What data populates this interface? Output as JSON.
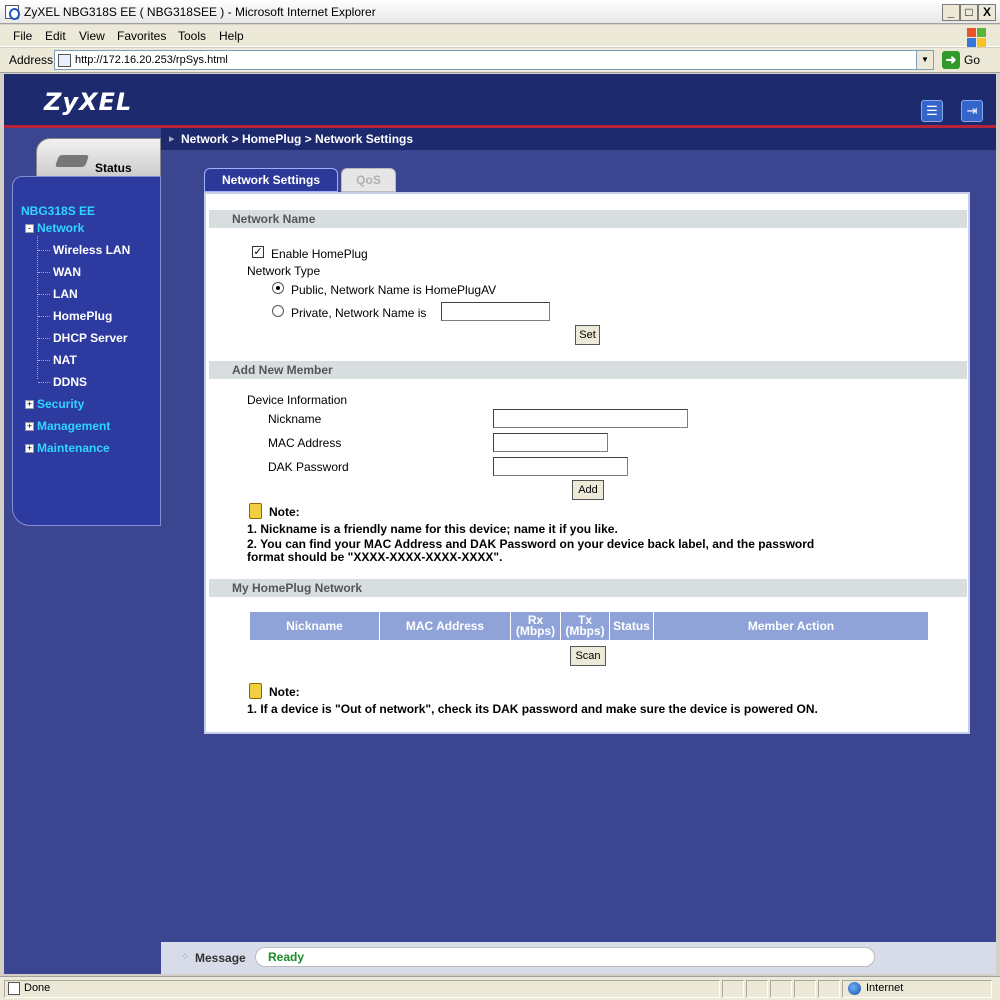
{
  "window": {
    "title": "ZyXEL NBG318S EE ( NBG318SEE ) - Microsoft Internet Explorer",
    "minimize": "_",
    "maximize": "□",
    "close": "X"
  },
  "menu": [
    "File",
    "Edit",
    "View",
    "Favorites",
    "Tools",
    "Help"
  ],
  "address": {
    "label": "Address",
    "url": "http://172.16.20.253/rpSys.html",
    "go_label": "Go"
  },
  "header": {
    "logo": "ZyXEL"
  },
  "breadcrumb": "Network > HomePlug > Network Settings",
  "sidebar": {
    "status_label": "Status",
    "device": "NBG318S EE",
    "network_label": "Network",
    "network_items": [
      "Wireless LAN",
      "WAN",
      "LAN",
      "HomePlug",
      "DHCP Server",
      "NAT",
      "DDNS"
    ],
    "security_label": "Security",
    "management_label": "Management",
    "maintenance_label": "Maintenance",
    "collapse_symbol": "-",
    "expand_symbol": "+"
  },
  "tabs": {
    "network_settings": "Network Settings",
    "qos": "QoS"
  },
  "network_name": {
    "section_title": "Network Name",
    "enable_label": "Enable HomePlug",
    "enable_checked": true,
    "network_type_label": "Network Type",
    "public_label": "Public, Network Name is HomePlugAV",
    "private_label": "Private, Network Name is",
    "selected": "public",
    "private_value": "",
    "set_button": "Set"
  },
  "add_member": {
    "section_title": "Add New Member",
    "device_info_label": "Device Information",
    "nickname_label": "Nickname",
    "nickname_value": "",
    "mac_label": "MAC Address",
    "mac_value": "",
    "dak_label": "DAK Password",
    "dak_value": "",
    "add_button": "Add",
    "note_title": "Note:",
    "note_1": "1. Nickname is a friendly name for this device; name it if you like.",
    "note_2_line1": "2. You can find your MAC Address and DAK Password on your device back label, and the password",
    "note_2_line2": "format should be \"XXXX-XXXX-XXXX-XXXX\"."
  },
  "my_network": {
    "section_title": "My HomePlug Network",
    "columns": {
      "nickname": "Nickname",
      "mac": "MAC Address",
      "rx": "Rx (Mbps)",
      "tx": "Tx (Mbps)",
      "status": "Status",
      "action": "Member Action"
    },
    "scan_button": "Scan",
    "note_title": "Note:",
    "note_1": "1. If a device is \"Out of network\", check its DAK password and make sure the device is powered ON."
  },
  "message": {
    "label": "Message",
    "text": "Ready"
  },
  "statusbar": {
    "text": "Done",
    "zone": "Internet"
  },
  "colors": {
    "nav_highlight": "#2fd6ff",
    "header_bg": "#1e2a6e",
    "accent_red": "#b7233a",
    "ready_green": "#1a8a2a"
  }
}
